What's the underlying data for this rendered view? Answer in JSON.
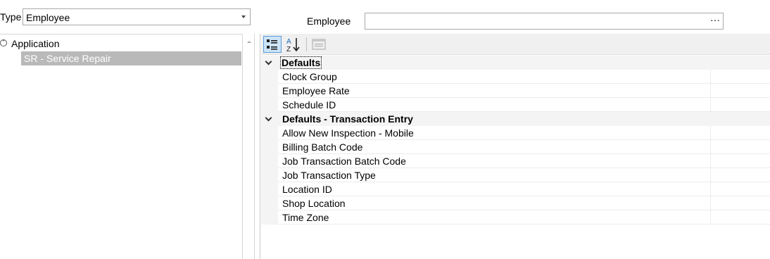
{
  "type_selector": {
    "label": "Type",
    "value": "Employee"
  },
  "employee_field": {
    "label": "Employee",
    "value": "",
    "ellipsis": "···"
  },
  "tree": {
    "root": {
      "label": "Application",
      "toggle_symbol": "⌃"
    },
    "selected": {
      "label": "SR - Service Repair"
    }
  },
  "toolbar": {
    "buttons": [
      {
        "name": "categorized-view",
        "icon": "categorized-icon",
        "active": true
      },
      {
        "name": "alphabetical-sort",
        "icon": "sort-az-icon",
        "active": false
      },
      {
        "name": "property-pages",
        "icon": "property-pages-icon",
        "active": false,
        "disabled": true
      }
    ]
  },
  "property_grid": {
    "categories": [
      {
        "name": "Defaults",
        "properties": [
          "Clock Group",
          "Employee Rate",
          "Schedule ID"
        ]
      },
      {
        "name": "Defaults - Transaction Entry",
        "properties": [
          "Allow New Inspection - Mobile",
          "Billing Batch Code",
          "Job Transaction Batch Code",
          "Job Transaction Type",
          "Location ID",
          "Shop Location",
          "Time Zone"
        ]
      }
    ]
  },
  "colors": {
    "selection": "#b9b9b9",
    "toolbar_active": "#cce4f7",
    "category_bg": "#f4f4f4"
  }
}
